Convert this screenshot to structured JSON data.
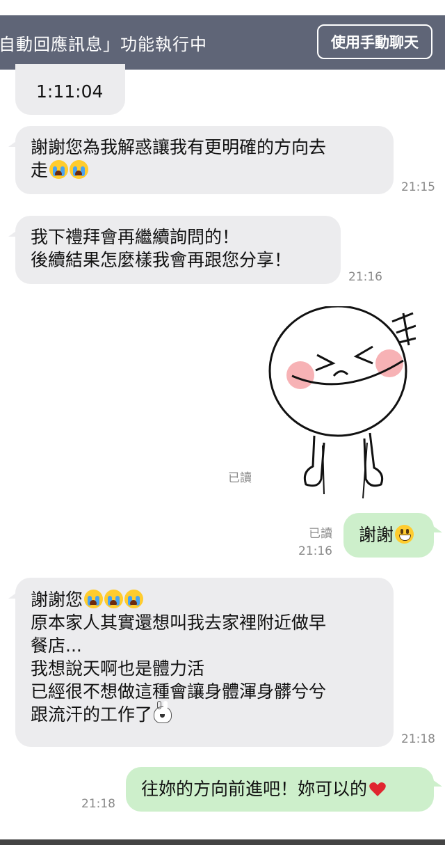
{
  "banner": {
    "status_text": "自動回應訊息」功能執行中",
    "manual_chat_button": "使用手動聊天"
  },
  "messages": [
    {
      "side": "in",
      "lines": [
        "1:11:04"
      ]
    },
    {
      "side": "in",
      "lines": [
        "謝謝您為我解惑讓我有更明確的方向去",
        "走"
      ],
      "emoji": [
        "crying-face-emoji",
        "crying-face-emoji"
      ],
      "time": "21:15"
    },
    {
      "side": "in",
      "lines": [
        "我下禮拜會再繼續詢問的！",
        "後續結果怎麼樣我會再跟您分享！"
      ],
      "time": "21:16"
    },
    {
      "side": "out",
      "type": "sticker",
      "sticker": "laughing-moon-character-sticker",
      "read": "已讀"
    },
    {
      "side": "out",
      "lines": [
        "謝謝"
      ],
      "emoji": [
        "grinning-face-emoji"
      ],
      "read": "已讀",
      "time": "21:16"
    },
    {
      "side": "in",
      "lines": [
        "謝謝您",
        "原本家人其實還想叫我去家裡附近做早",
        "餐店...",
        "我想說天啊也是體力活",
        "已經很不想做這種會讓身體渾身髒兮兮",
        "跟流汗的工作了"
      ],
      "emoji": [
        "crying-face-emoji",
        "crying-face-emoji",
        "crying-face-emoji",
        "bunny-emoji"
      ],
      "time": "21:18"
    },
    {
      "side": "out",
      "lines": [
        "往妳的方向前進吧！妳可以的"
      ],
      "emoji": [
        "red-heart-emoji"
      ],
      "time": "21:18"
    }
  ],
  "colors": {
    "banner": "#5f6577",
    "incoming_bubble": "#ececee",
    "outgoing_bubble": "#cdefcb",
    "meta_text": "#8a8a8a"
  }
}
